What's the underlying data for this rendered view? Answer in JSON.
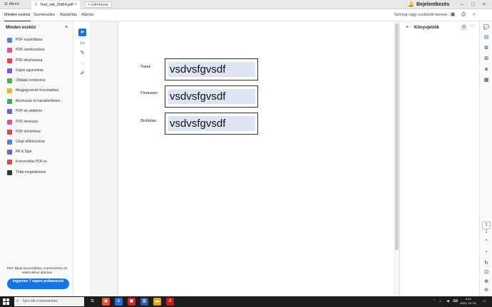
{
  "tabbar": {
    "menu_label": "Menü",
    "doc_tab_title": "Test_odt_Zid64.pdf",
    "new_tab_label": "Létrehozás",
    "signin_label": "Bejelentkezés"
  },
  "toolbar": {
    "items": [
      "Minden eszköz",
      "Szerkesztés",
      "Átalakítás",
      "Aláírás"
    ],
    "search_text": "Szöveg vagy eszközök keresé..."
  },
  "left_panel": {
    "title": "Minden eszköz",
    "tools": [
      {
        "label": "PDF exportálása",
        "icon": "export-pdf-icon",
        "color": "#5b7fe0"
      },
      {
        "label": "PDF szerkesztése",
        "icon": "edit-pdf-icon",
        "color": "#e0558c"
      },
      {
        "label": "PDF létrehozása",
        "icon": "create-pdf-icon",
        "color": "#e04848"
      },
      {
        "label": "Fájlok egyesítése",
        "icon": "combine-files-icon",
        "color": "#7e5bd6"
      },
      {
        "label": "Oldalak rendezése",
        "icon": "organize-pages-icon",
        "color": "#4fae5a"
      },
      {
        "label": "Megjegyzések hozzáadása",
        "icon": "comment-icon",
        "color": "#e8b830"
      },
      {
        "label": "Beolvasás és karakterfelism...",
        "icon": "scan-ocr-icon",
        "color": "#3fa86a"
      },
      {
        "label": "PDF-ek védelme",
        "icon": "protect-pdf-icon",
        "color": "#7a5cd6"
      },
      {
        "label": "PDF kivonása",
        "icon": "redact-pdf-icon",
        "color": "#e0558c"
      },
      {
        "label": "PDF tömörítése",
        "icon": "compress-pdf-icon",
        "color": "#e04848"
      },
      {
        "label": "Űrlap előkészítése",
        "icon": "prepare-form-icon",
        "color": "#5b7fe0"
      },
      {
        "label": "Fill & Sign",
        "icon": "fill-sign-icon",
        "color": "#7e5bd6"
      },
      {
        "label": "Konvertálás PDF-re",
        "icon": "convert-pdf-icon",
        "color": "#e04848"
      },
      {
        "label": "Több megtekintése",
        "icon": "more-tools-icon",
        "color": "#333333"
      }
    ],
    "footer_text": "PDF-fájlok konvertálása, szerkesztése és elektronikus aláírása",
    "trial_button": "Ingyenes 7 napos próbaverzió"
  },
  "form": {
    "fields": [
      {
        "label": "Name",
        "value": "vsdvsfgvsdf"
      },
      {
        "label": "Firstname",
        "value": "vsdvsfgvsdf"
      },
      {
        "label": "Birthdate",
        "value": "vsdvsfgvsdf"
      }
    ]
  },
  "right_panel": {
    "title": "Könyvjelzők"
  },
  "rail": {
    "page_current": "1",
    "page_total": "1"
  },
  "taskbar": {
    "search_placeholder": "Írjon ide a kereséshez",
    "clock_time": "8:44",
    "clock_date": "2023. 10. 01."
  },
  "colors": {
    "accent": "#1473e6",
    "field_fill": "#dde4f3"
  }
}
